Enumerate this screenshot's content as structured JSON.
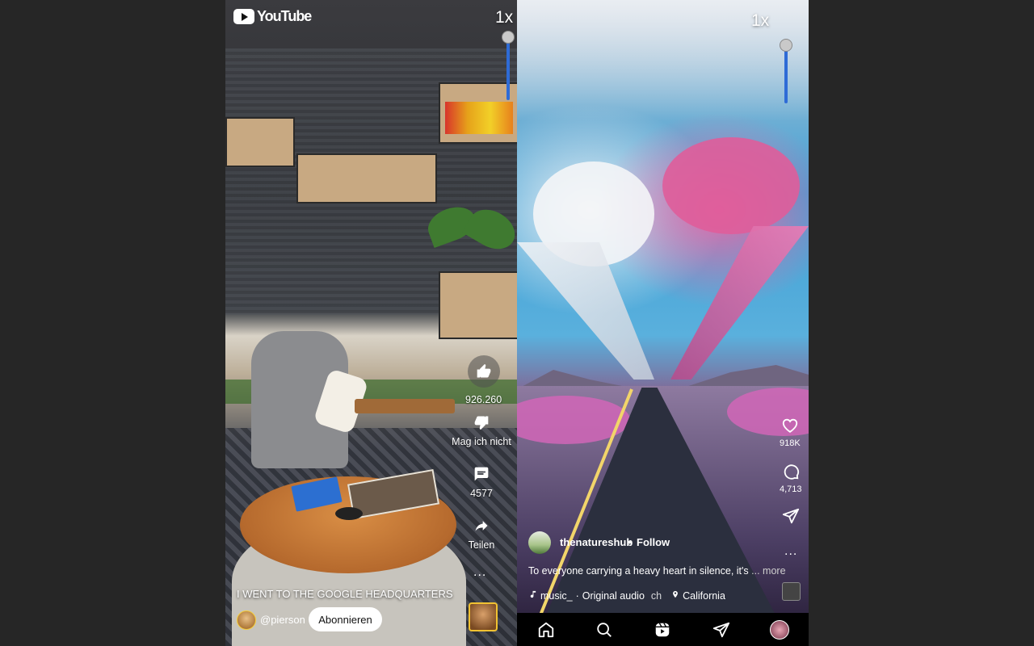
{
  "youtube": {
    "logo_text": "YouTube",
    "speed": "1x",
    "likes_count": "926.260",
    "dislike_label": "Mag ich nicht",
    "comments_count": "4577",
    "share_label": "Teilen",
    "more_label": "...",
    "title": "I WENT TO THE GOOGLE HEADQUARTERS",
    "channel": "@pierson",
    "subscribe_label": "Abonnieren",
    "speed_level": 0.55
  },
  "instagram": {
    "speed": "1x",
    "likes_count": "918K",
    "comments_count": "4,713",
    "username": "thenatureshub",
    "separator": "•",
    "follow_label": "Follow",
    "caption": "To everyone carrying a heavy heart in silence, it's",
    "caption_more": "... more",
    "audio_artist": "music_",
    "audio_separator": "·",
    "audio_title": "Original audio",
    "audio_extra": "ch",
    "location": "California",
    "more_label": "...",
    "speed_level": 0.55
  },
  "icons": {
    "yt_like": "thumbs-up-icon",
    "yt_dislike": "thumbs-down-icon",
    "yt_comment": "comment-icon",
    "yt_share": "share-arrow-icon",
    "ig_heart": "heart-icon",
    "ig_comment": "comment-icon",
    "ig_send": "send-icon",
    "nav": [
      "home-icon",
      "search-icon",
      "reels-icon",
      "send-icon",
      "profile-avatar"
    ]
  },
  "colors": {
    "slider_accent": "#2e6bd6",
    "subscribe_bg": "#ffffff",
    "background": "#262626"
  }
}
